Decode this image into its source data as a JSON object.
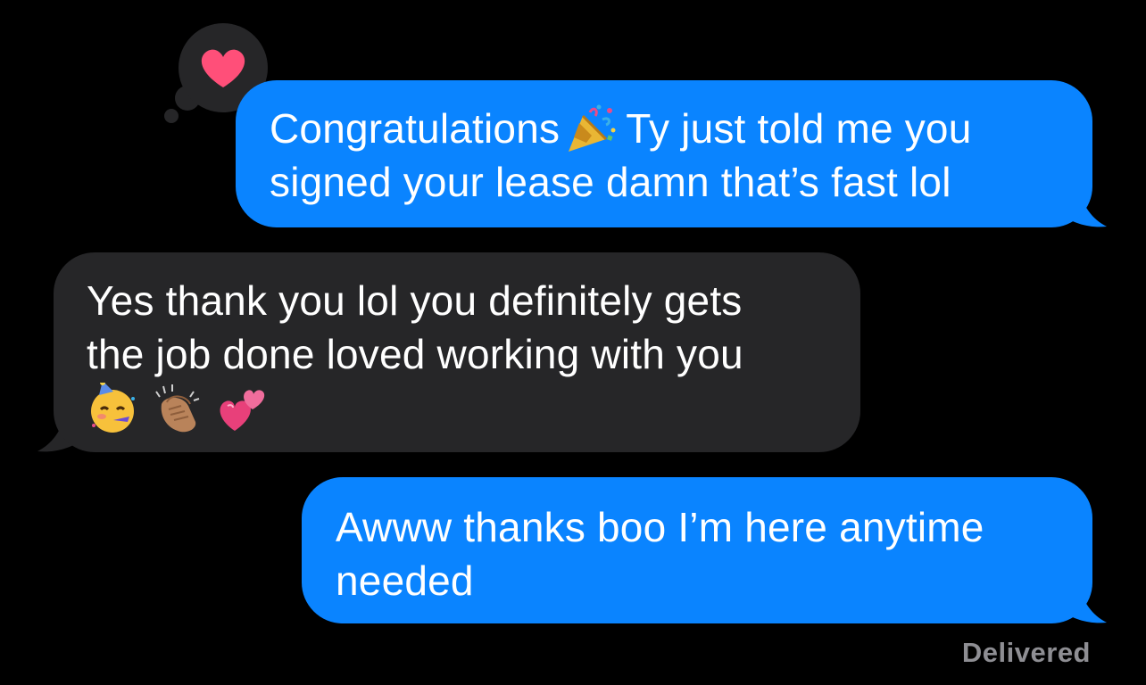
{
  "conversation": {
    "messages": [
      {
        "direction": "outgoing",
        "lines": [
          "Congratulations",
          "Ty just told me you",
          "signed your lease damn that’s fast lol"
        ],
        "inline_emoji": "party-popper-icon",
        "reaction": "heart-icon"
      },
      {
        "direction": "incoming",
        "lines": [
          "Yes thank you lol you definitely gets",
          "the job done loved working with you"
        ],
        "emojis": [
          "partying-face-icon",
          "clapping-hands-icon",
          "two-hearts-icon"
        ]
      },
      {
        "direction": "outgoing",
        "lines": [
          "Awww thanks boo I’m here anytime",
          "needed"
        ]
      }
    ],
    "status": "Delivered"
  },
  "colors": {
    "background": "#000000",
    "sent_bubble": "#0a84ff",
    "received_bubble": "#262628",
    "reaction_heart": "#ff4f79",
    "status_text": "#8e8e93"
  }
}
